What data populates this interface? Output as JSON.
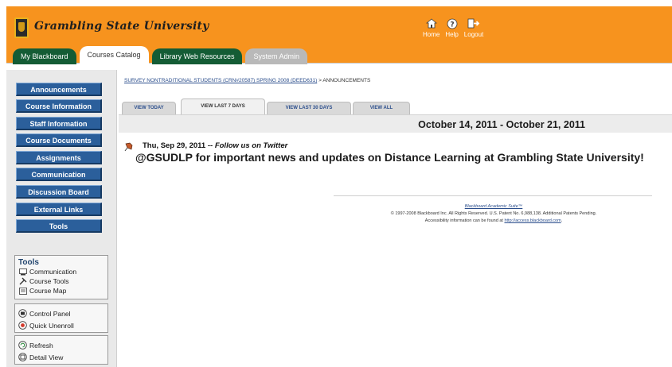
{
  "header": {
    "university": "Grambling State University",
    "links": [
      {
        "label": "Home",
        "icon": "home-icon"
      },
      {
        "label": "Help",
        "icon": "help-icon"
      },
      {
        "label": "Logout",
        "icon": "logout-icon"
      }
    ],
    "tabs": [
      "My Blackboard",
      "Courses Catalog",
      "Library Web Resources",
      "System Admin"
    ],
    "colors": {
      "bar": "#f7931e",
      "tab_dark": "#145c35",
      "tab_grey": "#b9b9b9"
    }
  },
  "sidebar": {
    "buttons": [
      "Announcements",
      "Course Information",
      "Staff Information",
      "Course Documents",
      "Assignments",
      "Communication",
      "Discussion Board",
      "External Links",
      "Tools"
    ],
    "button_color": "#2b5f9b",
    "tools_title": "Tools",
    "tools": [
      {
        "label": "Communication",
        "icon": "communication-icon"
      },
      {
        "label": "Course Tools",
        "icon": "course-tools-icon"
      },
      {
        "label": "Course Map",
        "icon": "course-map-icon"
      }
    ],
    "panel": [
      {
        "label": "Control Panel",
        "icon": "control-panel-icon"
      },
      {
        "label": "Quick Unenroll",
        "icon": "quick-unenroll-icon"
      }
    ],
    "view": [
      {
        "label": "Refresh",
        "icon": "refresh-icon"
      },
      {
        "label": "Detail View",
        "icon": "detail-view-icon"
      }
    ]
  },
  "main": {
    "breadcrumb_link": "SURVEY NONTRADITIONAL STUDENTS (CRN#20587) SPRING 2008 (DEED631)",
    "breadcrumb_sep": " > ",
    "breadcrumb_current": "ANNOUNCEMENTS",
    "view_tabs": [
      "VIEW TODAY",
      "VIEW LAST 7 DAYS",
      "VIEW LAST 30 DAYS",
      "VIEW ALL"
    ],
    "active_view_tab": "VIEW LAST 7 DAYS",
    "date_range": "October 14, 2011 - October 21, 2011",
    "announcement": {
      "date": "Thu, Sep 29, 2011",
      "separator": " -- ",
      "subject": "Follow us on Twitter",
      "body": "@GSUDLP for important news and updates on Distance Learning at Grambling State University!"
    },
    "footer": {
      "suite": "Blackboard Academic Suite™",
      "copyright": "© 1997-2008 Blackboard Inc. All Rights Reserved. U.S. Patent No. 6,988,138. Additional Patents Pending.",
      "access_text": "Accessibility information can be found at ",
      "access_link": "http://access.blackboard.com",
      "access_end": "."
    }
  }
}
